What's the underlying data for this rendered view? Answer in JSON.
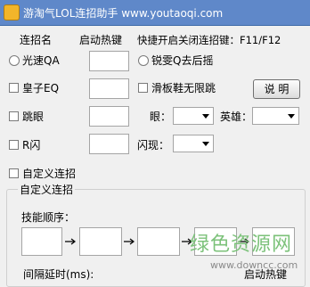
{
  "window": {
    "title": "游淘气LOL连招助手 www.youtaoqi.com"
  },
  "header": {
    "col_combo": "连招名",
    "col_hotkey": "启动热键",
    "shortcut_info": "快捷开启关闭连招键：F11/F12"
  },
  "rows": {
    "flash_qa": {
      "label": "光速QA",
      "checked": false
    },
    "ruisi": {
      "label": "锐雯Q去后摇",
      "checked": false
    },
    "huangzi": {
      "label": "皇子EQ",
      "checked": false
    },
    "slide": {
      "label": "滑板鞋无限跳",
      "checked": false
    },
    "tiaoyan": {
      "label": "跳眼",
      "checked": false
    },
    "rflash": {
      "label": "R闪",
      "checked": false
    },
    "custom": {
      "label": "自定义连招",
      "checked": false
    }
  },
  "buttons": {
    "help": "说 明"
  },
  "selects": {
    "eye_label": "眼：",
    "hero_label": "英雄：",
    "flash_label": "闪现："
  },
  "custom_group": {
    "title": "自定义连招",
    "skill_order": "技能顺序：",
    "interval": "间隔延时(ms):",
    "hotkey": "启动热键"
  },
  "watermark": {
    "cn": "绿色资源网",
    "url": "www.downcc.com"
  },
  "colors": {
    "titlebar": "#5f88c9",
    "watermark": "#7cc27a"
  }
}
